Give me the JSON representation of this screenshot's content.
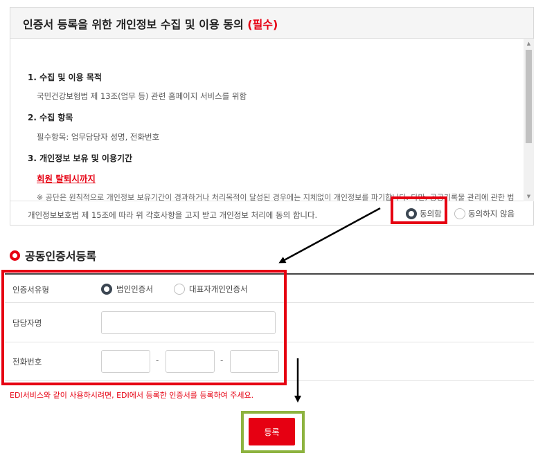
{
  "consent": {
    "title": "인증서 등록을 위한 개인정보 수집 및 이용 동의",
    "required": "(필수)",
    "sections": [
      {
        "heading": "1. 수집 및 이용 목적",
        "text": "국민건강보험법 제 13조(업무 등) 관련 홈페이지 서비스를 위함"
      },
      {
        "heading": "2. 수집 항목",
        "text": "필수항목: 업무담당자 성명, 전화번호"
      },
      {
        "heading": "3. 개인정보 보유 및 이용기간",
        "link": "회원 탈퇴시까지",
        "note": "※ 공단은 원칙적으로 개인정보 보유기간이 경과하거나 처리목적이 달성된 경우에는 지체없이 개인정보를 파기합니다. 다만, 공공기록물 관리에 관한 법"
      }
    ],
    "statement": "개인정보보호법 제 15조에 따라 위 각호사항을 고지 받고 개인정보 처리에 동의 합니다.",
    "agree_label": "동의함",
    "disagree_label": "동의하지 않음",
    "selected": "agree"
  },
  "registration": {
    "title": "공동인증서등록",
    "cert_type_label": "인증서유형",
    "cert_type_options": [
      "법인인증서",
      "대표자개인인증서"
    ],
    "cert_type_selected": 0,
    "manager_name_label": "담당자명",
    "manager_name_value": "",
    "phone_label": "전화번호",
    "phone_parts": [
      "",
      "",
      ""
    ],
    "phone_separator": "-",
    "notice": "EDI서비스와 같이 사용하시려면, EDI에서 등록한 인증서를 등록하여 주세요.",
    "submit_label": "등록"
  },
  "colors": {
    "accent_red": "#e60012",
    "highlight_green": "#8db33f",
    "radio_checked": "#3b4652"
  }
}
